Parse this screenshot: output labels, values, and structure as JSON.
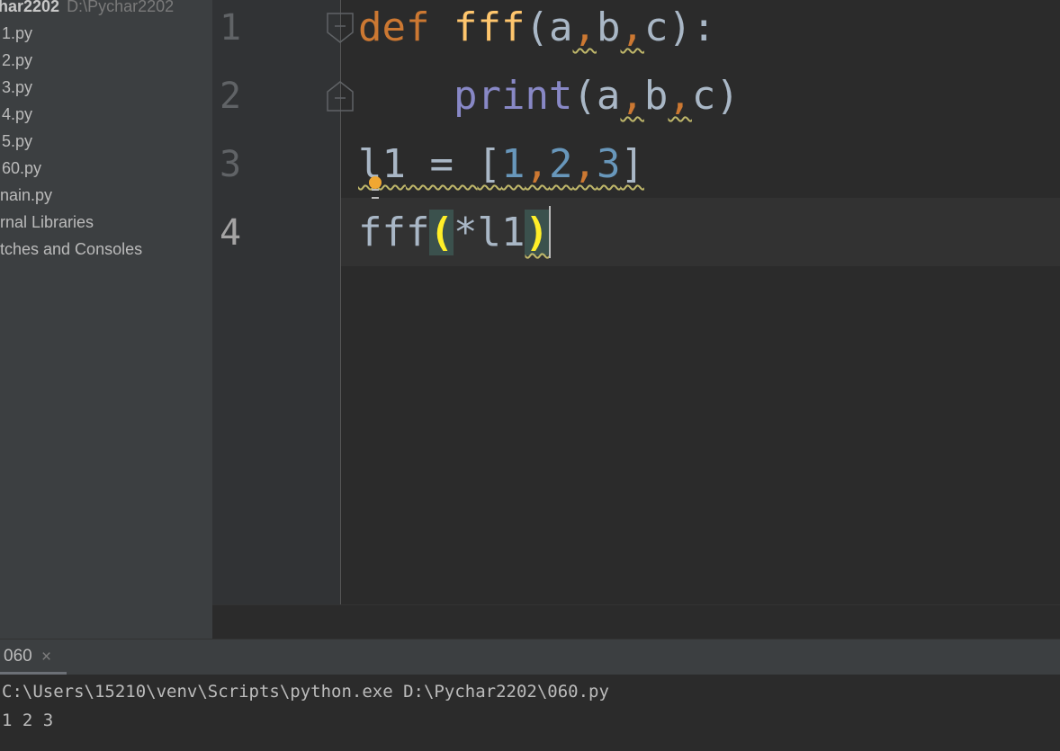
{
  "project": {
    "root_name": "har2202",
    "root_path": "D:\\Pychar2202",
    "files": [
      "1.py",
      "2.py",
      "3.py",
      "4.py",
      "5.py",
      "60.py",
      "nain.py"
    ],
    "extra_items": [
      "rnal Libraries",
      "tches and Consoles"
    ]
  },
  "editor": {
    "line_numbers": [
      "1",
      "2",
      "3",
      "4"
    ],
    "line1": {
      "kw": "def",
      "fn": "fff",
      "open": "(",
      "a": "a",
      "comma1": ",",
      "b": "b",
      "comma2": ",",
      "c": "c",
      "close": "):"
    },
    "line2": {
      "bi": "print",
      "open": "(",
      "a": "a",
      "comma1": ",",
      "b": "b",
      "comma2": ",",
      "c": "c",
      "close": ")"
    },
    "line3": {
      "var": "l1",
      "assign": " = ",
      "lbr": "[",
      "n1": "1",
      "comma1": ",",
      "n2": "2",
      "comma2": ",",
      "n3": "3",
      "rbr": "]"
    },
    "line4": {
      "fn": "fff",
      "open": "(",
      "star": "*",
      "arg": "l1",
      "close": ")"
    }
  },
  "run": {
    "tab_label": "060",
    "tab_close": "×",
    "console_lines": [
      "C:\\Users\\15210\\venv\\Scripts\\python.exe D:\\Pychar2202\\060.py",
      "1 2 3"
    ]
  },
  "colors": {
    "keyword": "#cc7832",
    "function": "#ffc66d",
    "builtin": "#8888c6",
    "number": "#6897bb",
    "brace_highlight": "#ffef28",
    "warning_underline": "#bfb76a",
    "bulb": "#f0a732"
  }
}
